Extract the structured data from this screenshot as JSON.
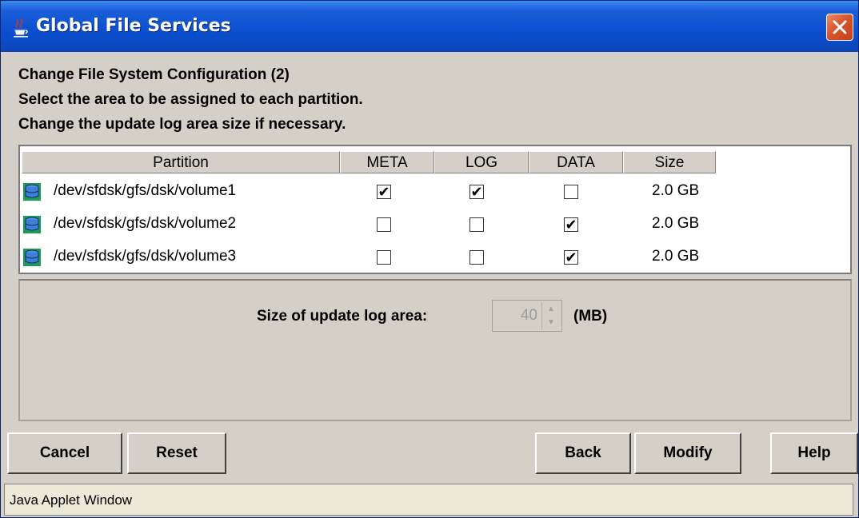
{
  "window": {
    "title": "Global File Services",
    "app_icon": "java-cup-icon",
    "close_icon": "close-icon"
  },
  "instructions": {
    "line1": "Change File System Configuration (2)",
    "line2": "Select the area to be assigned to each partition.",
    "line3": "Change the update log area size if necessary."
  },
  "table": {
    "headers": {
      "partition": "Partition",
      "meta": "META",
      "log": "LOG",
      "data": "DATA",
      "size": "Size"
    },
    "rows": [
      {
        "icon": "disk-icon",
        "partition": "/dev/sfdsk/gfs/dsk/volume1",
        "meta": true,
        "log": true,
        "data": false,
        "size": "2.0 GB"
      },
      {
        "icon": "disk-icon",
        "partition": "/dev/sfdsk/gfs/dsk/volume2",
        "meta": false,
        "log": false,
        "data": true,
        "size": "2.0 GB"
      },
      {
        "icon": "disk-icon",
        "partition": "/dev/sfdsk/gfs/dsk/volume3",
        "meta": false,
        "log": false,
        "data": true,
        "size": "2.0 GB"
      }
    ]
  },
  "log_area": {
    "label": "Size of update log area:",
    "value": "40",
    "unit": "(MB)",
    "enabled": false
  },
  "buttons": {
    "cancel": "Cancel",
    "reset": "Reset",
    "back": "Back",
    "modify": "Modify",
    "help": "Help"
  },
  "footer": {
    "text": "Java Applet Window"
  }
}
